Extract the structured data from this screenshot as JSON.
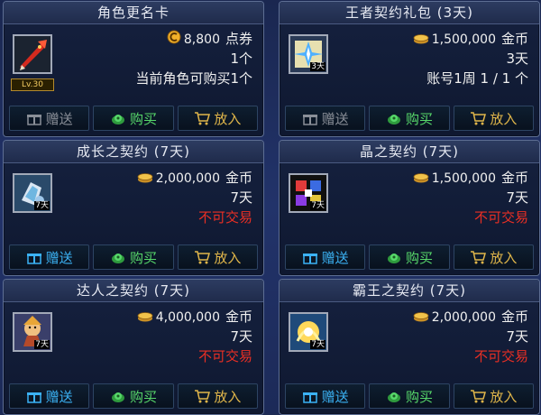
{
  "cards": [
    {
      "title": "角色更名卡",
      "icon": "red-feather-quill-icon",
      "level_badge": "Lv.30",
      "price": "8,800",
      "price_unit": "点券",
      "currency_icon": "cera-coin-icon",
      "line2": "1个",
      "line3": "当前角色可购买1个",
      "line3_red": false,
      "gift_label": "赠送",
      "buy_label": "购买",
      "put_label": "放入",
      "gift_enabled": false
    },
    {
      "title": "王者契约礼包 (3天)",
      "icon": "king-contract-package-icon",
      "icon_badge": "3天",
      "price": "1,500,000",
      "price_unit": "金币",
      "currency_icon": "gold-coin-icon",
      "line2": "3天",
      "line3": "账号1周 1 / 1 个",
      "line3_red": false,
      "gift_label": "赠送",
      "buy_label": "购买",
      "put_label": "放入",
      "gift_enabled": false
    },
    {
      "title": "成长之契约 (7天)",
      "icon": "growth-contract-icon",
      "icon_badge": "7天",
      "price": "2,000,000",
      "price_unit": "金币",
      "currency_icon": "gold-coin-icon",
      "line2": "7天",
      "line3": "不可交易",
      "line3_red": true,
      "gift_label": "赠送",
      "buy_label": "购买",
      "put_label": "放入",
      "gift_enabled": true
    },
    {
      "title": "晶之契约 (7天)",
      "icon": "crystal-contract-icon",
      "icon_badge": "7天",
      "price": "1,500,000",
      "price_unit": "金币",
      "currency_icon": "gold-coin-icon",
      "line2": "7天",
      "line3": "不可交易",
      "line3_red": true,
      "gift_label": "赠送",
      "buy_label": "购买",
      "put_label": "放入",
      "gift_enabled": true
    },
    {
      "title": "达人之契约 (7天)",
      "icon": "master-contract-icon",
      "icon_badge": "7天",
      "price": "4,000,000",
      "price_unit": "金币",
      "currency_icon": "gold-coin-icon",
      "line2": "7天",
      "line3": "不可交易",
      "line3_red": true,
      "gift_label": "赠送",
      "buy_label": "购买",
      "put_label": "放入",
      "gift_enabled": true
    },
    {
      "title": "霸王之契约 (7天)",
      "icon": "overlord-contract-icon",
      "icon_badge": "7天",
      "price": "2,000,000",
      "price_unit": "金币",
      "currency_icon": "gold-coin-icon",
      "line2": "7天",
      "line3": "不可交易",
      "line3_red": true,
      "gift_label": "赠送",
      "buy_label": "购买",
      "put_label": "放入",
      "gift_enabled": true
    }
  ]
}
